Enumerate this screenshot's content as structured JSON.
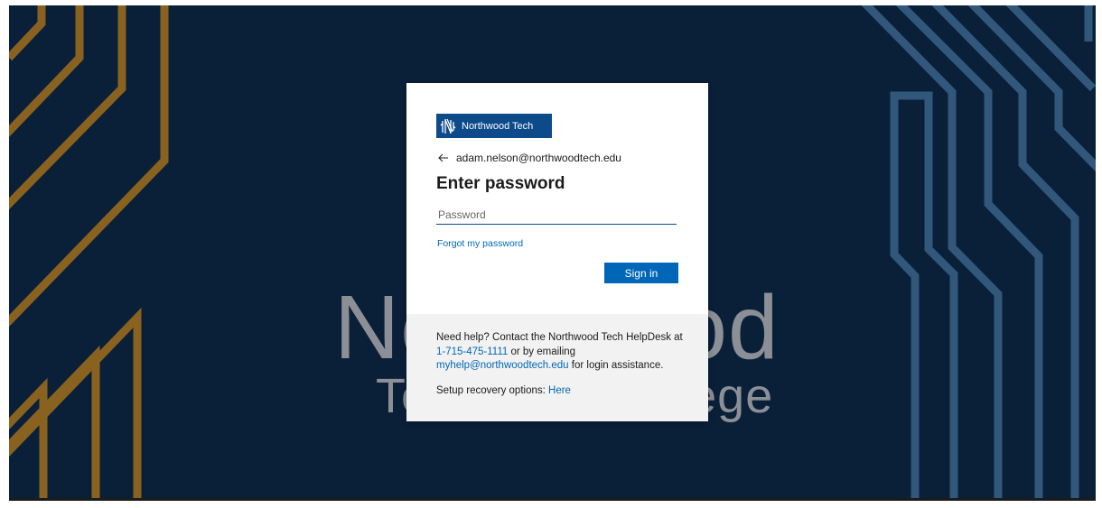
{
  "background": {
    "watermark_line1": "Northwood",
    "watermark_line2": "Technical College",
    "colors": {
      "navy": "#0a2039",
      "gold": "#8a6220",
      "steel": "#31577a"
    }
  },
  "card": {
    "logo": {
      "icon": "northwood-tech-logo-icon",
      "text": "Northwood Tech"
    },
    "identity": {
      "back_icon": "back-arrow-icon",
      "email": "adam.nelson@northwoodtech.edu"
    },
    "title": "Enter password",
    "password": {
      "placeholder": "Password",
      "value": ""
    },
    "forgot_link": "Forgot my password",
    "signin_label": "Sign in",
    "colors": {
      "accent": "#0067b8",
      "logo_bg": "#0d4a8a"
    }
  },
  "help": {
    "prefix": "Need help? Contact the Northwood Tech HelpDesk at ",
    "phone": "1-715-475-1111",
    "middle": " or by emailing ",
    "email": "myhelp@northwoodtech.edu",
    "suffix": " for login assistance.",
    "recovery_label": "Setup recovery options: ",
    "recovery_link": "Here"
  }
}
